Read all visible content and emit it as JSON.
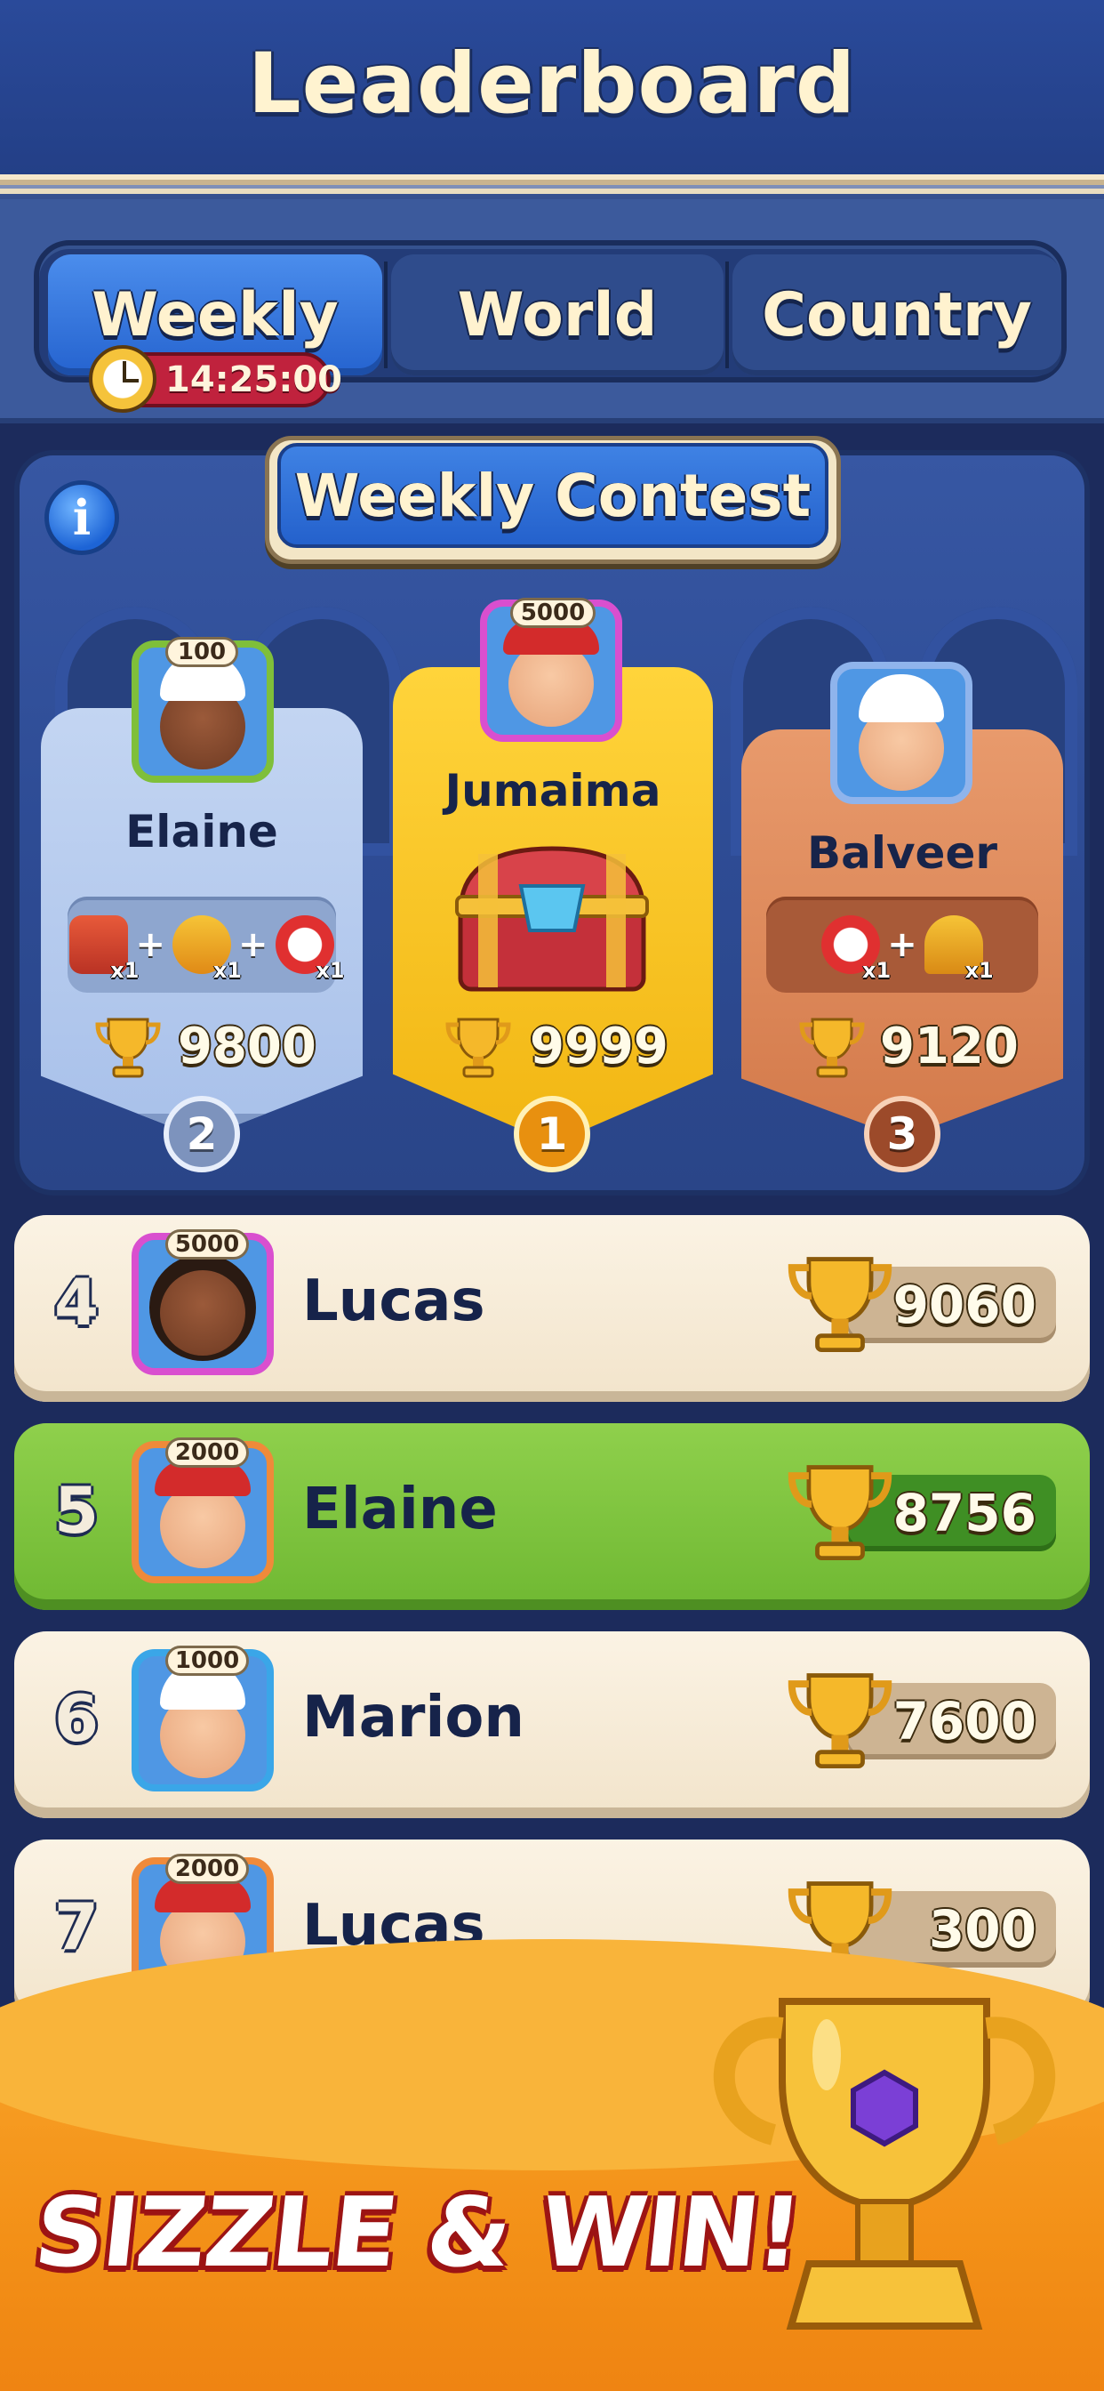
{
  "header": {
    "title": "Leaderboard"
  },
  "tabs": [
    {
      "label": "Weekly",
      "active": true
    },
    {
      "label": "World",
      "active": false
    },
    {
      "label": "Country",
      "active": false
    }
  ],
  "timer": {
    "value": "14:25:00",
    "icon": "stopwatch-icon"
  },
  "contest": {
    "title": "Weekly Contest",
    "info_icon": "info-icon",
    "podium": [
      {
        "rank": "1",
        "name": "Jumaima",
        "score": "9999",
        "avatar_badge": "5000",
        "reward": "treasure-chest-icon"
      },
      {
        "rank": "2",
        "name": "Elaine",
        "score": "9800",
        "avatar_badge": "100",
        "rewards": [
          {
            "icon": "crate-icon",
            "qty": "x1"
          },
          {
            "icon": "blowtorch-icon",
            "qty": "x1"
          },
          {
            "icon": "timer-icon",
            "qty": "x1"
          }
        ]
      },
      {
        "rank": "3",
        "name": "Balveer",
        "score": "9120",
        "rewards": [
          {
            "icon": "timer-icon",
            "qty": "x1"
          },
          {
            "icon": "bell-icon",
            "qty": "x1"
          }
        ]
      }
    ]
  },
  "rows": [
    {
      "rank": "4",
      "name": "Lucas",
      "score": "9060",
      "avatar_badge": "5000",
      "highlight": false
    },
    {
      "rank": "5",
      "name": "Elaine",
      "score": "8756",
      "avatar_badge": "2000",
      "highlight": true
    },
    {
      "rank": "6",
      "name": "Marion",
      "score": "7600",
      "avatar_badge": "1000",
      "highlight": false
    },
    {
      "rank": "7",
      "name": "Lucas",
      "score": "300",
      "avatar_badge": "2000",
      "highlight": false
    }
  ],
  "promo": {
    "text": "SIZZLE & WIN!",
    "icon": "gold-trophy-icon"
  },
  "colors": {
    "header": "#2a4a9a",
    "active_tab": "#2f6fe0",
    "gold": "#f5b719",
    "highlight_row": "#7cc43e",
    "promo": "#f39017"
  }
}
